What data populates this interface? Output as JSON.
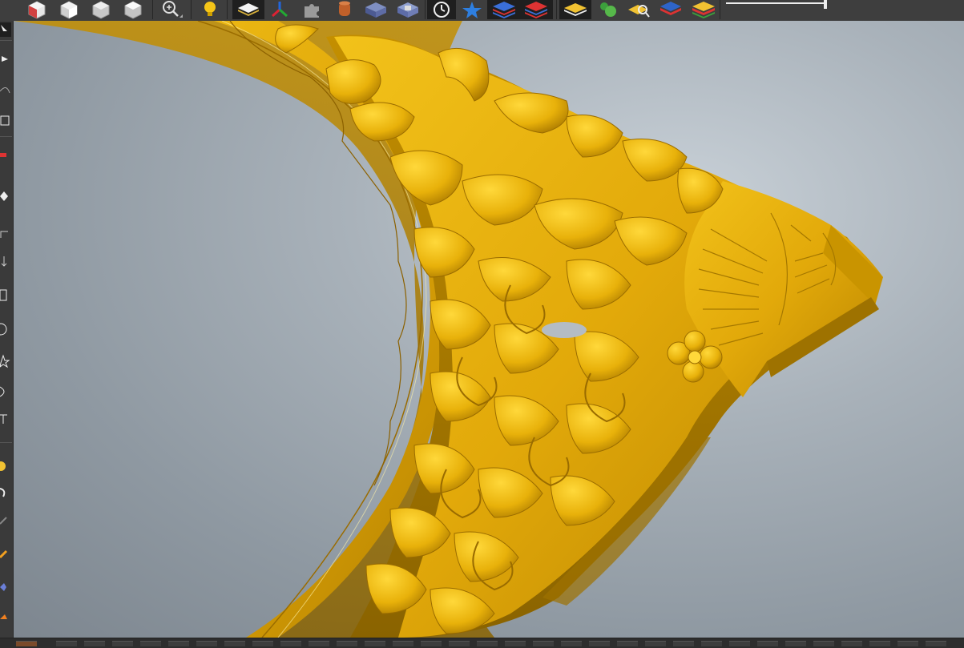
{
  "app": {
    "theme": "dark",
    "accent": "#e8b10a"
  },
  "toolbar": {
    "icons": [
      "view-iso-red-icon",
      "view-front-icon",
      "view-right-icon",
      "view-top-icon",
      "zoom-icon",
      "light-bulb-icon",
      "layer-white-icon",
      "axes-icon",
      "puzzle-icon",
      "cylinder-icon",
      "box-blue-icon",
      "box-view-icon",
      "history-clock-icon",
      "star-icon",
      "layers-blue-icon",
      "layers-red-icon",
      "layer-yellow-icon",
      "group-green-icon",
      "search-layers-icon",
      "layer-stack-icon",
      "layer-stack-color-icon"
    ],
    "slider": {
      "value": 1.0
    }
  },
  "left_toolbar": {
    "tools": [
      "select-tool-icon",
      "node-tool-icon",
      "arc-tool-icon",
      "transform-tool-icon",
      "pen-red-tool-icon",
      "eraser-tool-icon",
      "corner-tool-icon",
      "offset-tool-icon",
      "rectangle-tool-icon",
      "circle-tool-icon",
      "star-tool-icon",
      "arc-draw-tool-icon",
      "text-tool-icon",
      "sculpt-tool-icon",
      "smooth-tool-icon",
      "pencil-tool-icon",
      "highlight-tool-icon",
      "gem-tool-icon",
      "orange-tool-icon"
    ]
  },
  "viewport": {
    "background_center": "#c9d1d8",
    "background_edge": "#7d868f",
    "model_color": "#e8b10a",
    "model_shadow": "#a87800"
  }
}
